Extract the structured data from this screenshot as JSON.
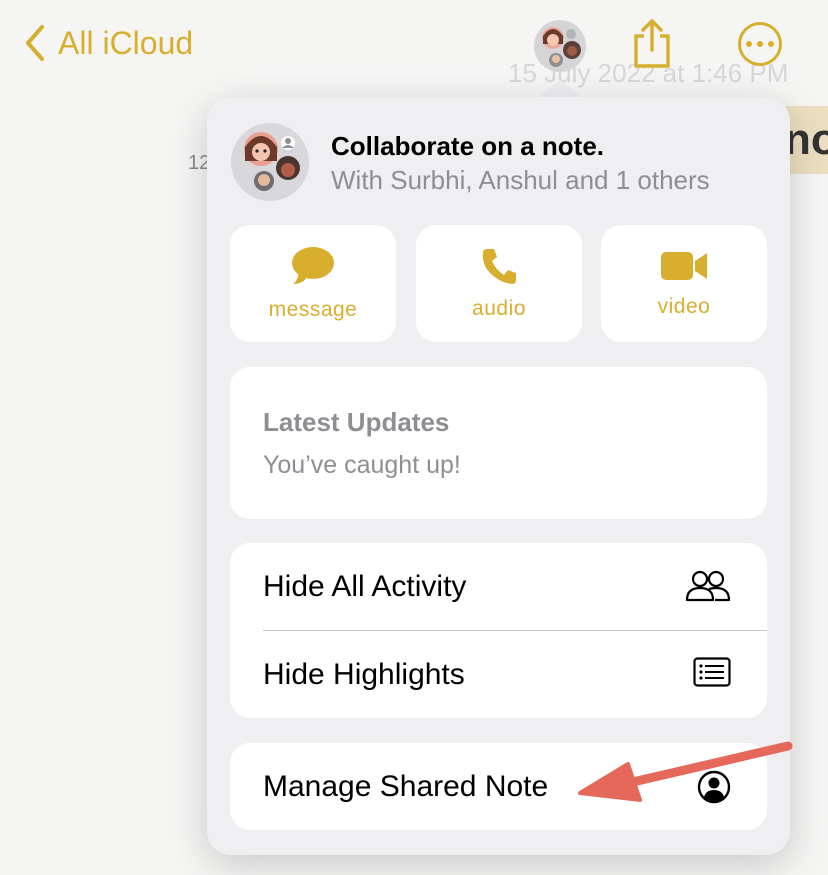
{
  "header": {
    "back_label": "All iCloud",
    "bg_date": "15 July 2022 at 1:46 PM",
    "bg_number": "12",
    "bg_title": "no"
  },
  "collab": {
    "title": "Collaborate on a note.",
    "subtitle": "With Surbhi, Anshul and 1 others"
  },
  "actions": [
    {
      "label": "message",
      "icon": "message-bubble-icon"
    },
    {
      "label": "audio",
      "icon": "phone-icon"
    },
    {
      "label": "video",
      "icon": "video-camera-icon"
    }
  ],
  "updates": {
    "title": "Latest Updates",
    "subtitle": "You’ve caught up!"
  },
  "menu": [
    {
      "label": "Hide All Activity",
      "icon": "people-icon"
    },
    {
      "label": "Hide Highlights",
      "icon": "list-icon"
    }
  ],
  "manage": {
    "label": "Manage Shared Note",
    "icon": "person-circle-icon"
  },
  "colors": {
    "accent": "#d8ae2e",
    "annotation_arrow": "#e5695b",
    "popover_bg": "#efeff2"
  }
}
